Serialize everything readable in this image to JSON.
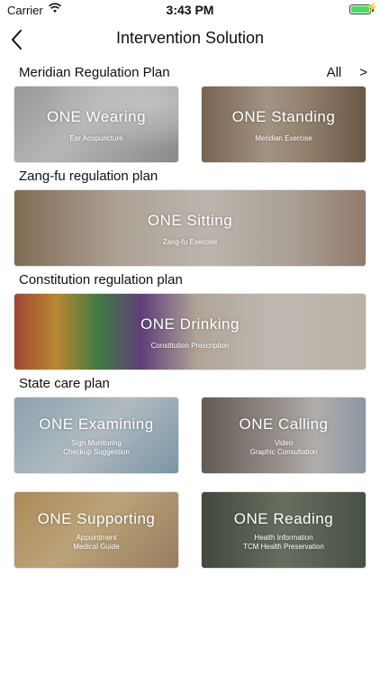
{
  "status": {
    "carrier": "Carrier",
    "time": "3:43 PM"
  },
  "nav": {
    "title": "Intervention Solution"
  },
  "sections": {
    "meridian": "Meridian Regulation Plan",
    "all_label": "All",
    "all_arrow": ">",
    "zangfu": "Zang-fu regulation plan",
    "constitution": "Constitution regulation plan",
    "state": "State care plan"
  },
  "cards": {
    "wearing": {
      "title": "ONE Wearing",
      "sub1": "Ear Acupuncture"
    },
    "standing": {
      "title": "ONE Standing",
      "sub1": "Meridian Exercise"
    },
    "sitting": {
      "title": "ONE Sitting",
      "sub1": "Zang-fu Exercise"
    },
    "drinking": {
      "title": "ONE Drinking",
      "sub1": "Constitution Prescription"
    },
    "examining": {
      "title": "ONE Examining",
      "sub1": "Sign Monitoring",
      "sub2": "Checkup Suggestion"
    },
    "calling": {
      "title": "ONE Calling",
      "sub1": "Video",
      "sub2": "Graphic Consultation"
    },
    "supporting": {
      "title": "ONE Supporting",
      "sub1": "Appointment",
      "sub2": "Medical Guide"
    },
    "reading": {
      "title": "ONE Reading",
      "sub1": "Health Information",
      "sub2": "TCM Health Preservation"
    }
  },
  "icons": {
    "back": "chevron-left-icon",
    "wifi": "wifi-icon",
    "battery": "battery-icon"
  },
  "colors": {
    "battery": "#4cd964"
  }
}
